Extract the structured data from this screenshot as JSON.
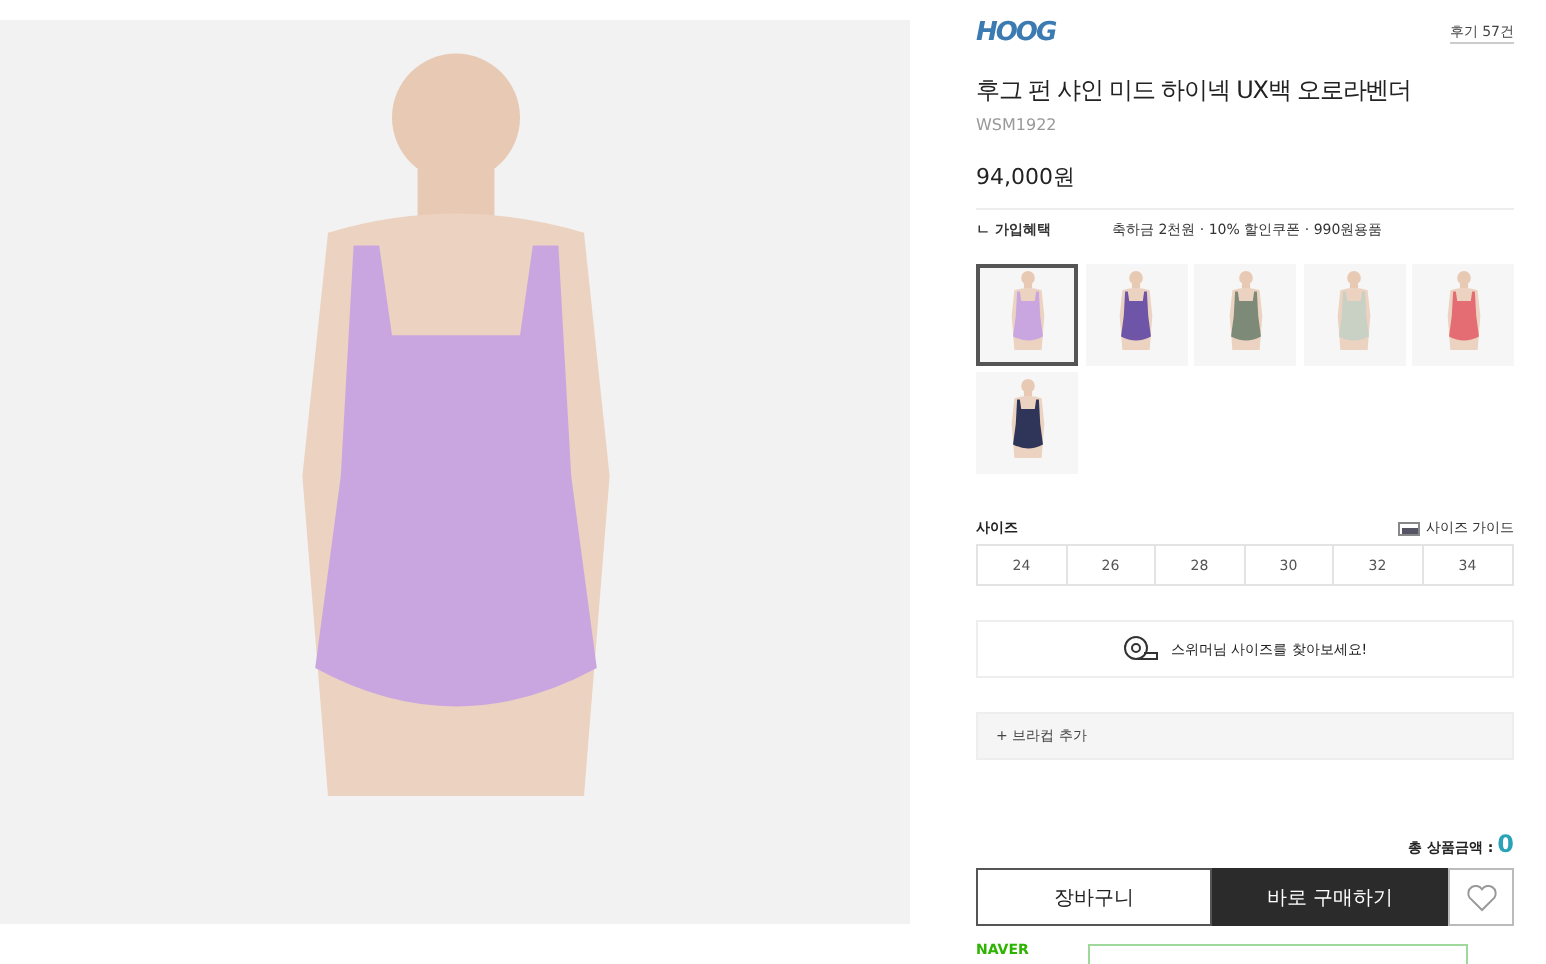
{
  "brand": {
    "logo": "HOOG"
  },
  "review_link": "후기 57건",
  "product": {
    "title": "후그 펀 샤인 미드 하이넥 UX백 오로라벤더",
    "code": "WSM1922",
    "price": "94,000원"
  },
  "benefit": {
    "label": "ㄴ 가입혜택",
    "text": "축하금 2천원 · 10% 할인쿠폰 · 990원용품"
  },
  "colors": [
    {
      "color": "#c9a6e0",
      "selected": true
    },
    {
      "color": "#6f55a8",
      "selected": false
    },
    {
      "color": "#7d8a78",
      "selected": false
    },
    {
      "color": "#c9d0c4",
      "selected": false
    },
    {
      "color": "#e36d72",
      "selected": false
    },
    {
      "color": "#2f3558",
      "selected": false
    }
  ],
  "size": {
    "label": "사이즈",
    "guide": "사이즈 가이드",
    "options": [
      {
        "label": "24",
        "selected": false
      },
      {
        "label": "26",
        "selected": false
      },
      {
        "label": "28",
        "selected": false
      },
      {
        "label": "30",
        "selected": false
      },
      {
        "label": "32",
        "selected": false
      },
      {
        "label": "34",
        "selected": false
      }
    ]
  },
  "find_size": "스위머님 사이즈를 찾아보세요!",
  "bra_cup": "+ 브라컵 추가",
  "total": {
    "label": "총 상품금액 :",
    "value": "0"
  },
  "buttons": {
    "cart": "장바구니",
    "buy": "바로 구매하기"
  },
  "naver": "NAVER"
}
